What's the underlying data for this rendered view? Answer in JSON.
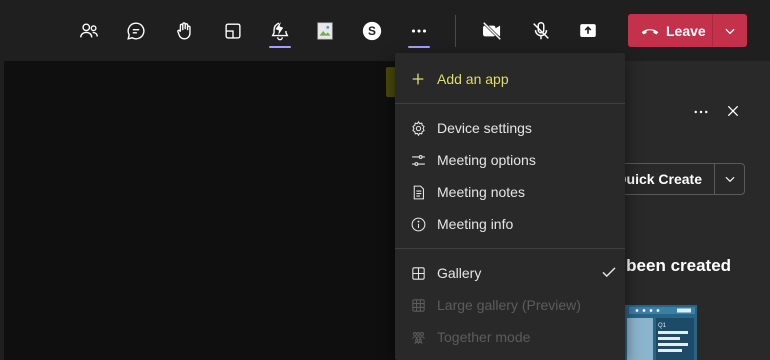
{
  "toolbar": {
    "buttons": [
      {
        "name": "people-icon"
      },
      {
        "name": "chat-icon"
      },
      {
        "name": "raise-hand-icon"
      },
      {
        "name": "breakout-rooms-icon"
      },
      {
        "name": "app-icon"
      },
      {
        "name": "broken-image-icon"
      },
      {
        "name": "skype-icon"
      },
      {
        "name": "more-icon"
      },
      {
        "name": "camera-off-icon"
      },
      {
        "name": "mic-off-icon"
      },
      {
        "name": "share-icon"
      }
    ],
    "leave_label": "Leave"
  },
  "panel": {
    "quick_create_label": "Quick Create",
    "created_text": "e been created"
  },
  "menu": {
    "add_app": "Add an app",
    "device_settings": "Device settings",
    "meeting_options": "Meeting options",
    "meeting_notes": "Meeting notes",
    "meeting_info": "Meeting info",
    "gallery": "Gallery",
    "large_gallery": "Large gallery (Preview)",
    "together_mode": "Together mode"
  },
  "colors": {
    "leave": "#c4314b",
    "accent_underline": "#9ea2ff",
    "highlight": "#4b4b0a"
  }
}
